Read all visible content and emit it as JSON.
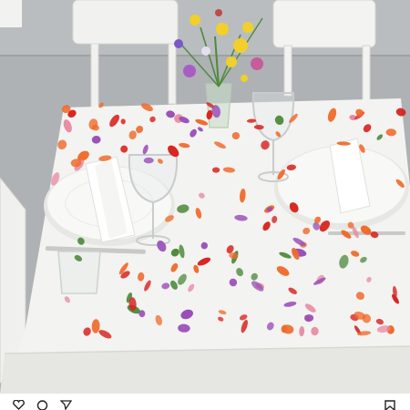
{
  "photo": {
    "subject": "table-setting-with-flower-petals",
    "palette": {
      "tablecloth": "#f4f4f2",
      "tablecloth_shadow": "#e2e2de",
      "floor": "#a9adb0",
      "plate": "#f7f7f5",
      "napkin": "#ffffff",
      "petal_orange": "#f06a2a",
      "petal_red": "#d8231f",
      "petal_pink": "#e88aa4",
      "petal_purple": "#9a4fb8",
      "leaf_green": "#4e8a3c",
      "yellow_flower": "#f2cf2a"
    }
  },
  "toolbar": {
    "icons": [
      "heart-icon",
      "comment-icon",
      "share-icon",
      "bookmark-icon"
    ]
  }
}
